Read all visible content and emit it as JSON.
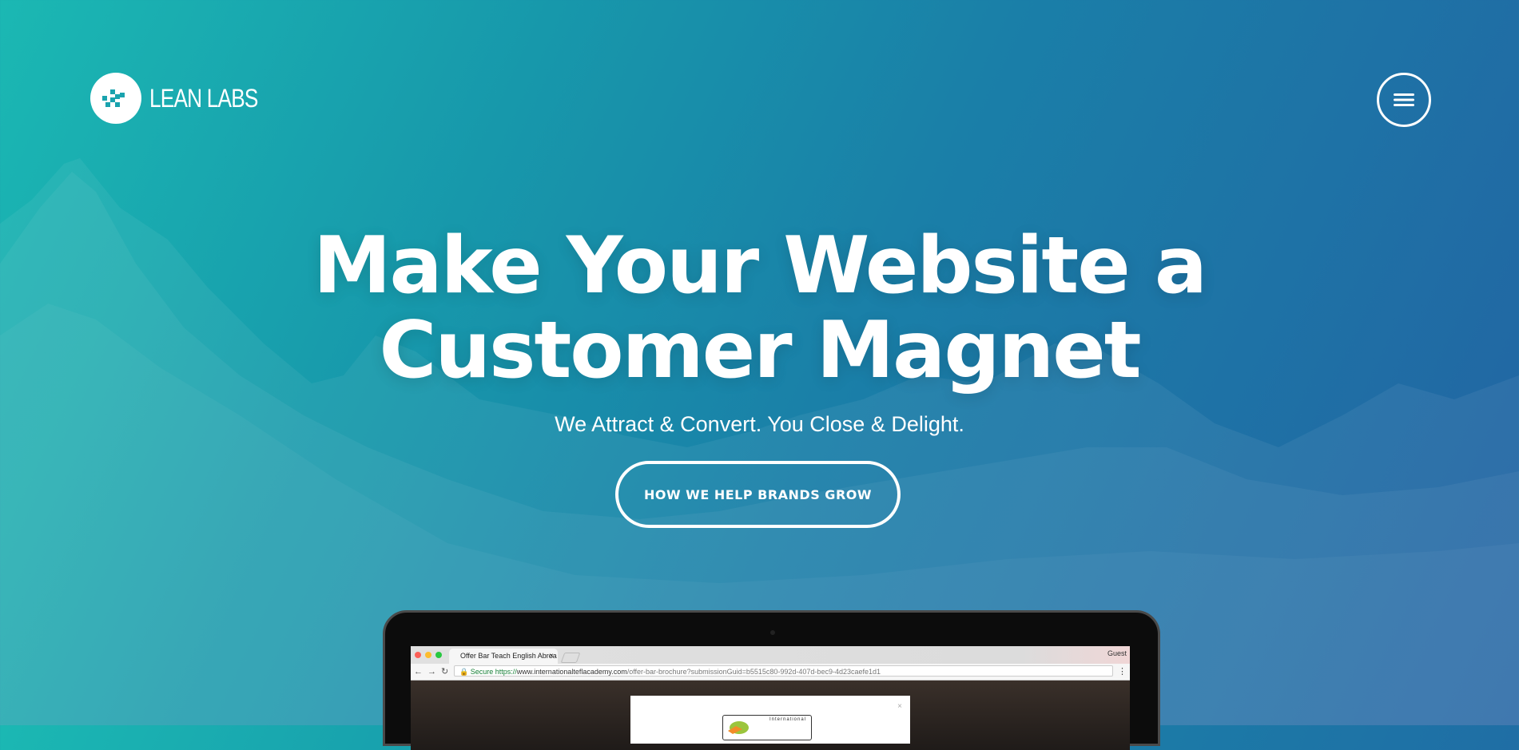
{
  "brand": {
    "name": "LEAN LABS",
    "icon": "checker-logo-icon"
  },
  "header": {
    "menu_icon": "hamburger-menu-icon"
  },
  "hero": {
    "title_line1": "Make Your Website a",
    "title_line2": "Customer Magnet",
    "subtitle": "We Attract & Convert. You Close & Delight.",
    "cta_label": "HOW WE HELP BRANDS GROW"
  },
  "mockup": {
    "browser_tab_title": "Offer Bar Teach English Abroa",
    "tab_close": "×",
    "profile_label": "Guest",
    "secure_label": "Secure",
    "url_scheme": "https://",
    "url_host": "www.internationalteflacademy.com",
    "url_path": "/offer-bar-brochure?submissionGuid=b5515c80-992d-407d-bec9-4d23caefe1d1",
    "modal_close": "×",
    "modal_logo_text": "International"
  },
  "colors": {
    "gradient_start": "#1bb8b3",
    "gradient_end": "#2363a3",
    "text": "#ffffff"
  }
}
